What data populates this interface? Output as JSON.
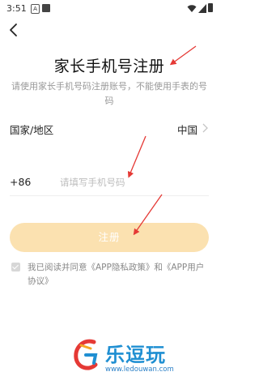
{
  "status_bar": {
    "time": "3:51",
    "notif_badge": "A"
  },
  "page": {
    "title": "家长手机号注册",
    "subtitle": "请使用家长手机号码注册账号，不能使用手表的号码"
  },
  "country": {
    "label": "国家/地区",
    "value": "中国"
  },
  "phone": {
    "code": "+86",
    "placeholder": "请填写手机号码",
    "value": ""
  },
  "submit": {
    "label": "注册"
  },
  "agreement": {
    "prefix": "我已阅读并同意",
    "privacy_link": "《APP隐私政策》",
    "conjunction": "和",
    "user_link": "《APP用户协议》",
    "checked": true
  },
  "watermark": {
    "name": "乐逗玩",
    "url": "www.ledouwan.com"
  },
  "colors": {
    "accent": "#fbe1b0",
    "annotation": "#e53935",
    "brand": "#1f8fd2"
  }
}
